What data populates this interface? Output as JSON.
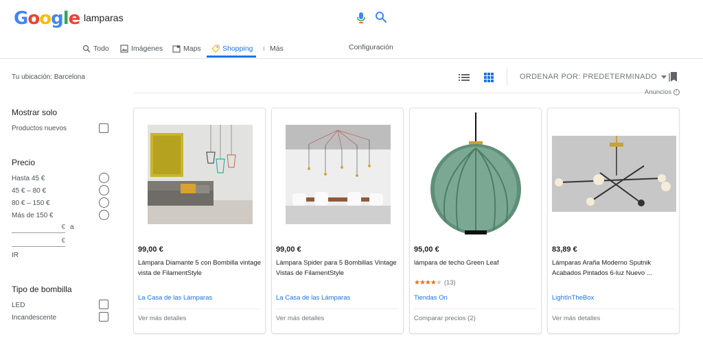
{
  "header": {
    "logo_letters": [
      "G",
      "o",
      "o",
      "g",
      "l",
      "e"
    ],
    "logo_colors": [
      "#4285f4",
      "#ea4335",
      "#fbbc05",
      "#4285f4",
      "#34a853",
      "#ea4335"
    ],
    "search_value": "lamparas",
    "icons": [
      "mic-icon",
      "search-icon"
    ]
  },
  "tabs": [
    {
      "label": "Todo",
      "icon": "search-icon",
      "active": false
    },
    {
      "label": "Imágenes",
      "icon": "image-icon",
      "active": false
    },
    {
      "label": "Maps",
      "icon": "map-icon",
      "active": false
    },
    {
      "label": "Shopping",
      "icon": "tag-icon",
      "active": true
    },
    {
      "label": "Más",
      "icon": "more-vert-icon",
      "active": false
    }
  ],
  "config_label": "Configuración",
  "location": "Tu ubicación: Barcelona",
  "toolbar": {
    "sort_label": "ORDENAR POR: PREDETERMINADO",
    "ads_label": "Anuncios",
    "icons": [
      "list-view-icon",
      "grid-view-icon",
      "bookmark-icon"
    ]
  },
  "sidebar": {
    "show_only": {
      "heading": "Mostrar solo",
      "option": "Productos nuevos"
    },
    "price": {
      "heading": "Precio",
      "options": [
        "Hasta 45 €",
        "45 € – 80 €",
        "80 € – 150 €",
        "Más de 150 €"
      ],
      "min_suffix": "€",
      "connector": "a",
      "max_suffix": "€",
      "go": "IR"
    },
    "bulb": {
      "heading": "Tipo de bombilla",
      "options": [
        "LED",
        "Incandescente"
      ]
    }
  },
  "accent": "#1a73e8",
  "products": [
    {
      "price": "99,00 €",
      "title": "Lámpara Diamante 5 con Bombilla vintage vista de FilamentStyle",
      "store": "La Casa de las Lámparas",
      "footer": "Ver más detalles"
    },
    {
      "price": "99,00 €",
      "title": "Lámpara Spider para 5 Bombillas Vintage Vistas de FilamentStyle",
      "store": "La Casa de las Lámparas",
      "footer": "Ver más detalles"
    },
    {
      "price": "95,00 €",
      "title": "lámpara de techo Green Leaf",
      "rating": 4,
      "rating_count": "(13)",
      "store": "Tiendas On",
      "footer": "Comparar precios (2)"
    },
    {
      "price": "83,89 €",
      "title": "Lámparas Araña Moderno Sputnik Acabados Pintados 6-luz Nuevo ...",
      "store": "LightInTheBox",
      "footer": "Ver más detalles"
    }
  ]
}
